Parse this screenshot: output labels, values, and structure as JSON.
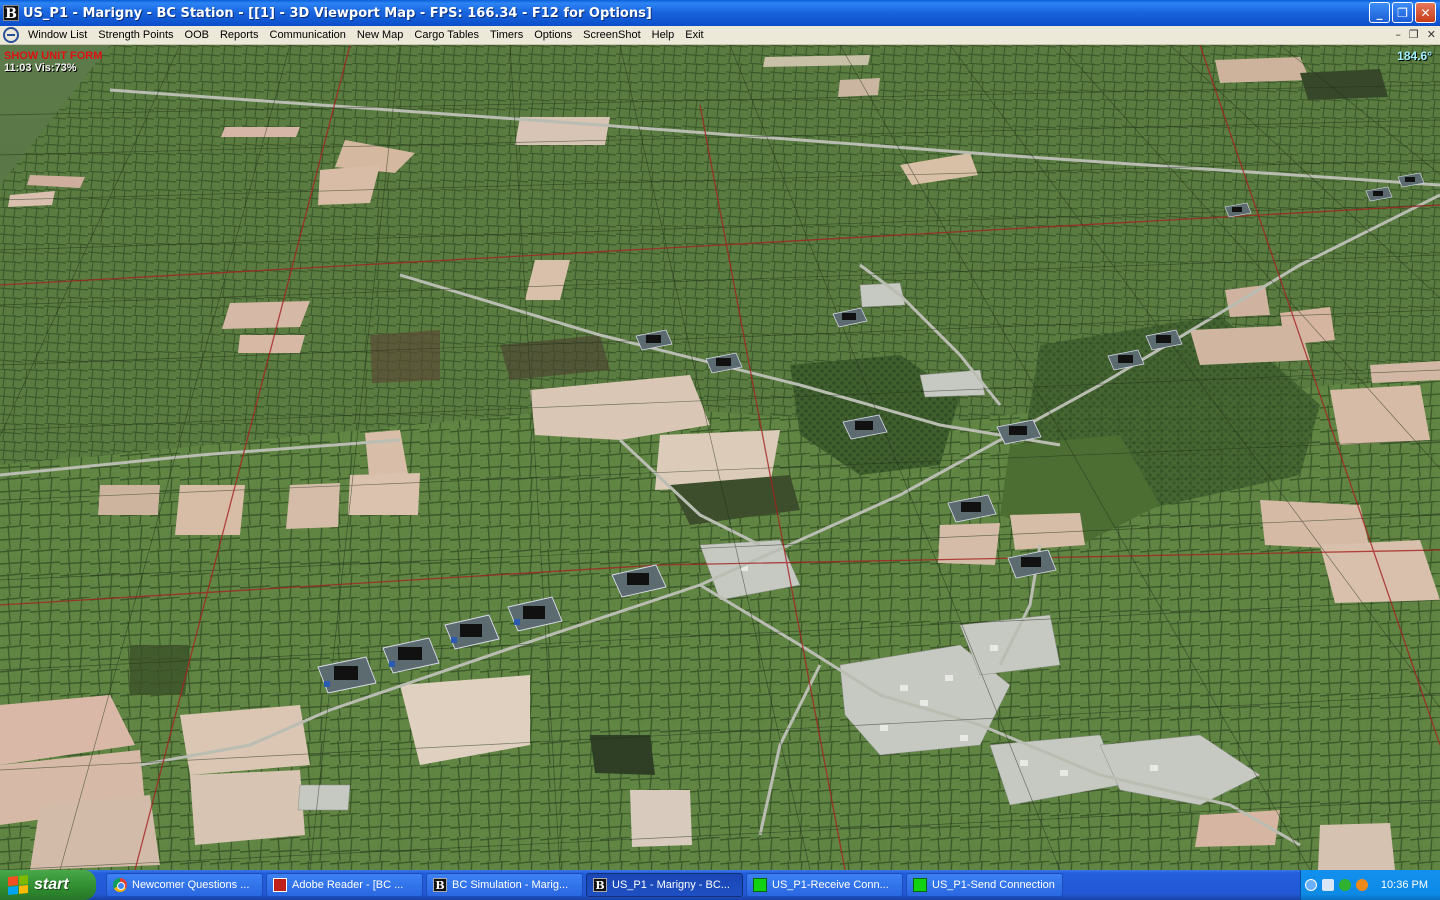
{
  "window": {
    "app_icon_letter": "B",
    "title": "US_P1 - Marigny - BC Station - [[1] - 3D Viewport Map - FPS: 166.34 - F12 for Options]",
    "buttons": {
      "minimize": "_",
      "restore": "❐",
      "close": "✕"
    }
  },
  "menu": {
    "items": [
      "Window List",
      "Strength Points",
      "OOB",
      "Reports",
      "Communication",
      "New Map",
      "Cargo Tables",
      "Timers",
      "Options",
      "ScreenShot",
      "Help",
      "Exit"
    ],
    "mdi": {
      "minimize": "–",
      "restore": "❐",
      "close": "✕"
    }
  },
  "hud": {
    "show_unit_form": "SHOW UNIT FORM",
    "time_visibility": "11:03 Vis:73%",
    "heading": "184.6°"
  },
  "map": {
    "units_count_label": "",
    "colors": {
      "terrain": "#54733d",
      "field_light": "#c9b7a3",
      "grid": "#2a3a22",
      "grid_red": "#a32020",
      "road": "#b8bcb0",
      "town": "#c4c6c0"
    }
  },
  "taskbar": {
    "start_label": "start",
    "tasks": [
      {
        "icon": "chrome-icon",
        "label": "Newcomer Questions ..."
      },
      {
        "icon": "pdf-icon",
        "label": "Adobe Reader - [BC ..."
      },
      {
        "icon": "b-app-icon",
        "label": "BC Simulation - Marig..."
      },
      {
        "icon": "b-app-icon",
        "label": "US_P1 - Marigny - BC..."
      },
      {
        "icon": "green-square-icon",
        "label": "US_P1-Receive Conn..."
      },
      {
        "icon": "green-square-icon",
        "label": "US_P1-Send Connection"
      }
    ],
    "active_task": 3,
    "clock": "10:36 PM"
  }
}
